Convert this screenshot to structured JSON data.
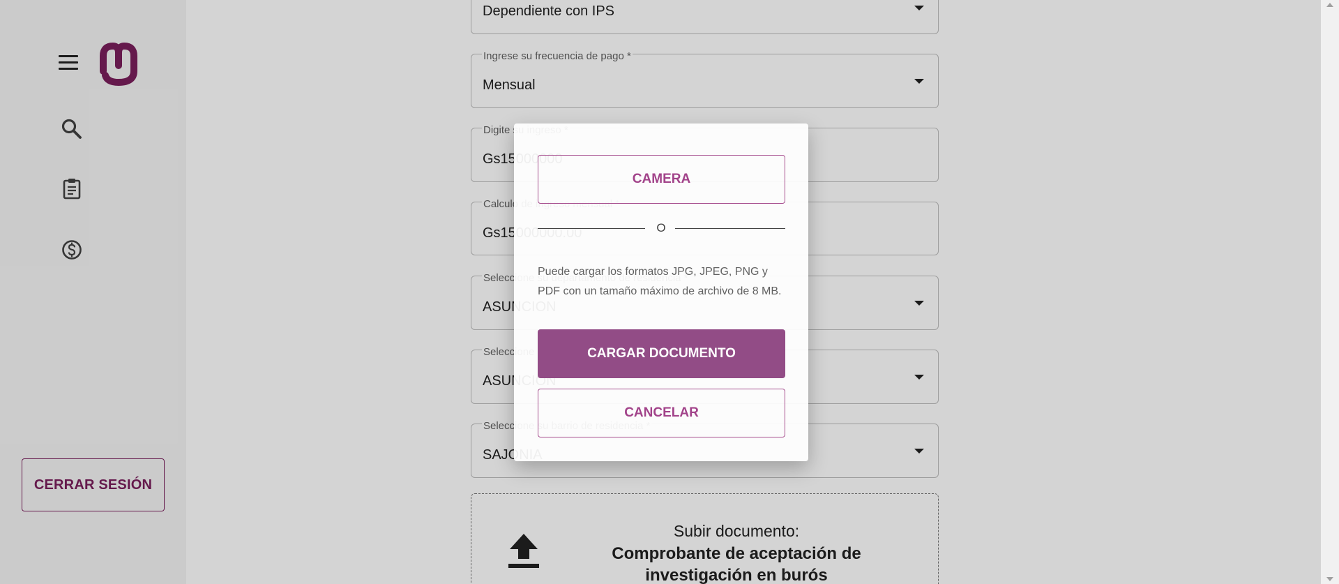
{
  "sidebar": {
    "logout_label": "CERRAR SESIÓN",
    "icons": [
      "menu-icon",
      "logo",
      "search-icon",
      "clipboard-icon",
      "dollar-circle-icon"
    ]
  },
  "form": {
    "employment_type": {
      "value": "Dependiente con IPS"
    },
    "pay_frequency": {
      "label": "Ingrese su frecuencia de pago *",
      "value": "Mensual"
    },
    "income": {
      "label": "Digite su ingreso *",
      "value": "Gs15000000"
    },
    "monthly_income": {
      "label": "Calculo de ingreso mensual *",
      "value": "Gs15000000.00"
    },
    "department": {
      "label": "Seleccione su departamento de residencia *",
      "value": "ASUNCION"
    },
    "district": {
      "label": "Seleccione su distrito *",
      "value": "ASUNCION"
    },
    "neighborhood": {
      "label": "Seleccione su barrio de residencia *",
      "value": "SAJONIA"
    }
  },
  "upload": {
    "title": "Subir documento:",
    "document": "Comprobante de aceptación de investigación en burós"
  },
  "dialog": {
    "camera_label": "CAMERA",
    "divider_text": "O",
    "info_text": "Puede cargar los formatos JPG, JPEG, PNG y PDF con un tamaño máximo de archivo de 8 MB.",
    "upload_label": "CARGAR DOCUMENTO",
    "cancel_label": "CANCELAR"
  },
  "colors": {
    "brand": "#7a1f5c",
    "accent": "#924c86",
    "overlay": "rgba(0,0,0,0.17)"
  }
}
